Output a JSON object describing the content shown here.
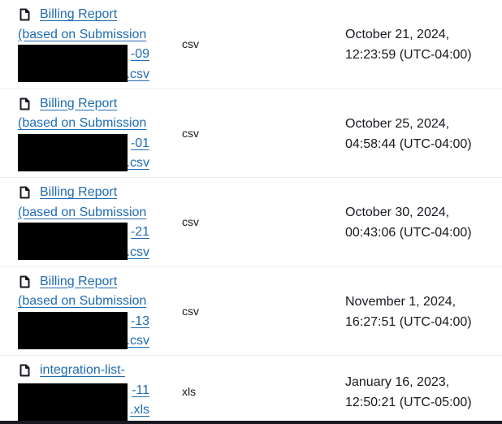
{
  "rows": [
    {
      "name_lines": [
        "Billing Report",
        "(based on Submission",
        "-09",
        ".csv"
      ],
      "type": "csv",
      "date_line1": "October 21, 2024,",
      "date_line2": "12:23:59 (UTC-04:00)"
    },
    {
      "name_lines": [
        "Billing Report",
        "(based on Submission",
        "-01",
        ".csv"
      ],
      "type": "csv",
      "date_line1": "October 25, 2024,",
      "date_line2": "04:58:44 (UTC-04:00)"
    },
    {
      "name_lines": [
        "Billing Report",
        "(based on Submission",
        "-21",
        ".csv"
      ],
      "type": "csv",
      "date_line1": "October 30, 2024,",
      "date_line2": "00:43:06 (UTC-04:00)"
    },
    {
      "name_lines": [
        "Billing Report",
        "(based on Submission",
        "-13",
        ".csv"
      ],
      "type": "csv",
      "date_line1": "November 1, 2024,",
      "date_line2": "16:27:51 (UTC-04:00)"
    },
    {
      "name_lines": [
        "integration-list-",
        "-11",
        ".xls"
      ],
      "type": "xls",
      "date_line1": "January 16, 2023,",
      "date_line2": "12:50:21 (UTC-05:00)"
    }
  ],
  "icons": {
    "file": "file-icon"
  }
}
